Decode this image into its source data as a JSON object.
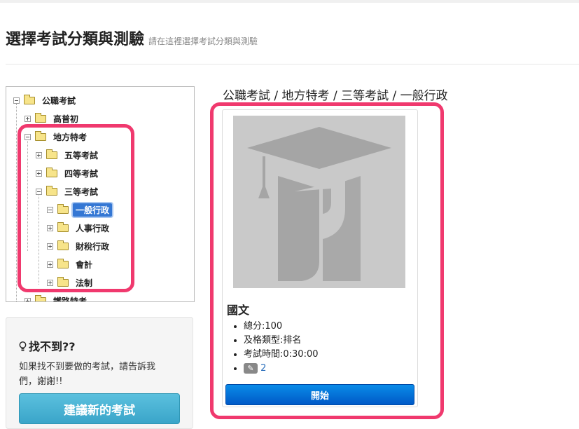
{
  "header": {
    "title": "選擇考試分類與測驗",
    "subtitle": "請在這裡選擇考試分類與測驗"
  },
  "tree": {
    "nodes": [
      {
        "label": "公職考試"
      },
      {
        "label": "高普初"
      },
      {
        "label": "地方特考"
      },
      {
        "label": "五等考試"
      },
      {
        "label": "四等考試"
      },
      {
        "label": "三等考試"
      },
      {
        "label": "一般行政"
      },
      {
        "label": "人事行政"
      },
      {
        "label": "財稅行政"
      },
      {
        "label": "會計"
      },
      {
        "label": "法制"
      },
      {
        "label": "鐵路特考"
      }
    ]
  },
  "help": {
    "icon": "lightbulb-icon",
    "title": "找不到??",
    "text": "如果找不到要做的考試，請告訴我們，謝謝!!",
    "button": "建議新的考試"
  },
  "breadcrumb": "公職考試 / 地方特考 / 三等考試 / 一般行政",
  "exam": {
    "title": "國文",
    "total_score": "總分:100",
    "pass_type": "及格類型:排名",
    "time": "考試時間:0:30:00",
    "attempts": "2",
    "attempt_icon": "pencil-icon",
    "start_label": "開始"
  },
  "colors": {
    "highlight": "#f0396e",
    "selected_node": "#3477d4",
    "start_button": "#0a72dc",
    "suggest_button": "#4ab3d8"
  }
}
